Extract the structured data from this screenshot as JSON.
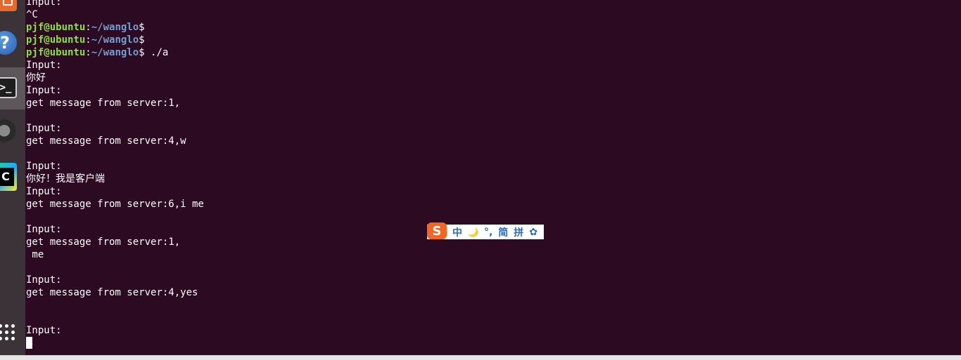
{
  "launcher": {
    "help_glyph": "?",
    "terminal_glyph": ">_",
    "clion_glyph": "C"
  },
  "terminal": {
    "prompt_user": "pjf@ubuntu",
    "prompt_colon": ":",
    "prompt_path": "~/wanglo",
    "prompt_dollar": "$",
    "command": " ./a",
    "lines": {
      "l0": "Input:",
      "l1": "^C",
      "l5": "Input:",
      "l6": "你好",
      "l7": "Input:",
      "l8": "get message from server:1,",
      "l10": "Input:",
      "l11": "get message from server:4,w",
      "l13": "Input:",
      "l14": "你好！我是客户端",
      "l15": "Input:",
      "l16": "get message from server:6,i me",
      "l18": "Input:",
      "l19": "get message from server:1,",
      "l20": " me",
      "l22": "Input:",
      "l23": "get message from server:4,yes",
      "l26": "Input:"
    }
  },
  "ime_bar": {
    "logo": "S",
    "mode": "中",
    "moon": "🌙",
    "punct": "°,",
    "simplified": "简",
    "pinyin": "拼",
    "settings": "✿"
  },
  "colors": {
    "background": "#2c0a22",
    "text": "#ffffff",
    "prompt_user": "#8ae234",
    "prompt_path": "#729fcf",
    "ime_accent": "#2b6cc4",
    "ime_logo": "#f26522"
  }
}
